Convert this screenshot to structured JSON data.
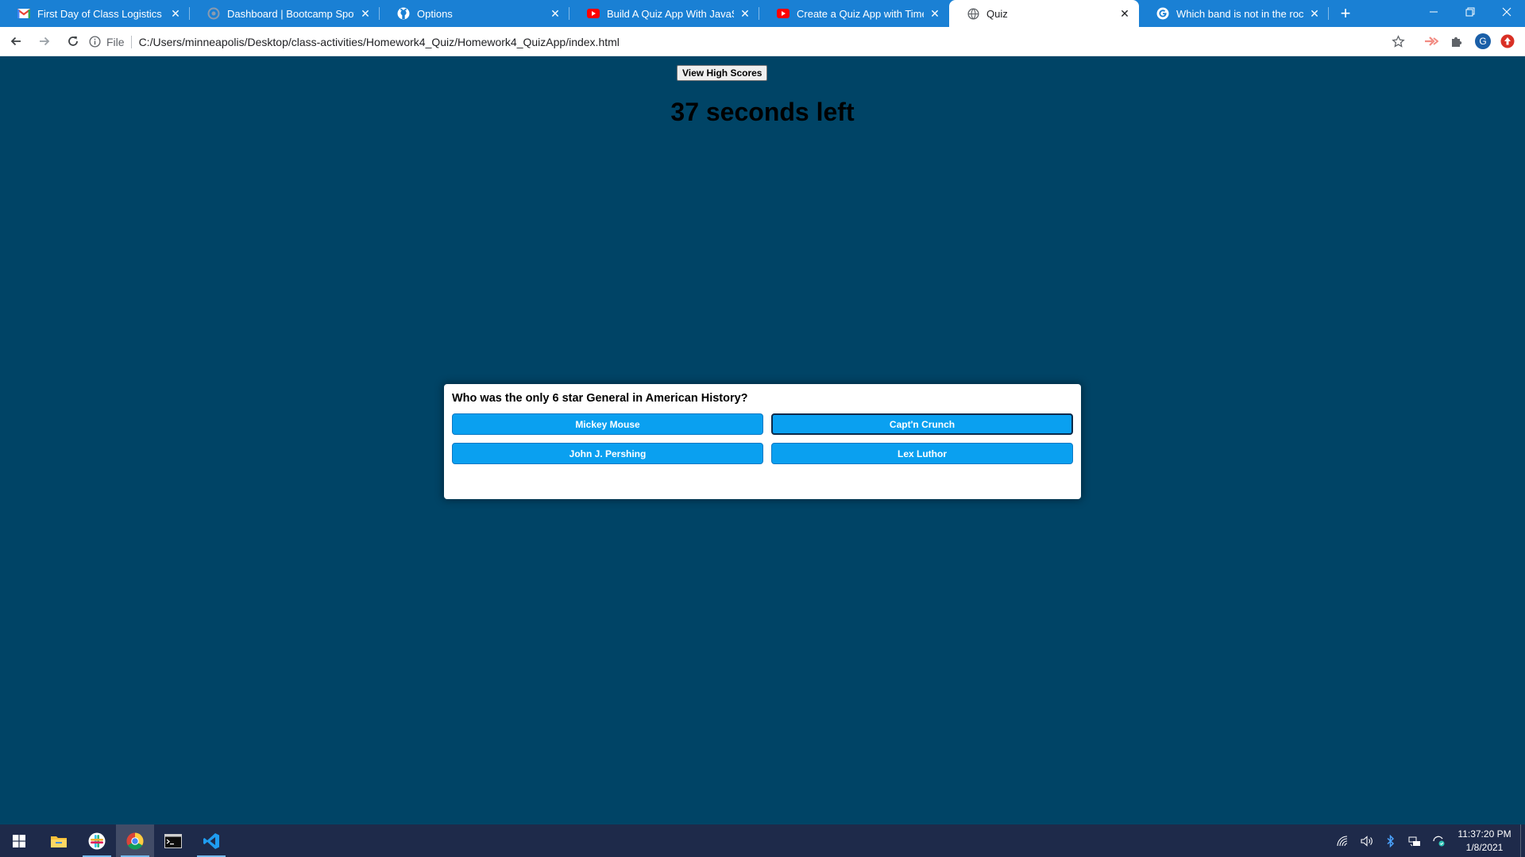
{
  "browser": {
    "tabs": [
      {
        "title": "First Day of Class Logistics - tony",
        "icon": "gmail-icon"
      },
      {
        "title": "Dashboard | Bootcamp Spot",
        "icon": "bootcamp-spot-icon"
      },
      {
        "title": "Options",
        "icon": "github-icon"
      },
      {
        "title": "Build A Quiz App With JavaScript",
        "icon": "youtube-icon"
      },
      {
        "title": "Create a Quiz App with Timer usi",
        "icon": "youtube-icon"
      },
      {
        "title": "Quiz",
        "icon": "globe-icon",
        "active": true
      },
      {
        "title": "Which band is not in the rock n r",
        "icon": "google-icon"
      }
    ],
    "address": {
      "scheme_label": "File",
      "url": "C:/Users/minneapolis/Desktop/class-activities/Homework4_Quiz/Homework4_QuizApp/index.html"
    },
    "profile_initial": "G"
  },
  "page": {
    "high_scores_label": "View High Scores",
    "timer_text": "37 seconds left",
    "quiz": {
      "question": "Who was the only 6 star General in American History?",
      "answers": [
        "Mickey Mouse",
        "Capt'n Crunch",
        "John J. Pershing",
        "Lex Luthor"
      ]
    }
  },
  "taskbar": {
    "pinned": [
      "windows-start-icon",
      "file-explorer-icon",
      "slack-icon",
      "chrome-icon",
      "terminal-icon",
      "vscode-icon"
    ],
    "clock": {
      "time": "11:37:20 PM",
      "date": "1/8/2021"
    }
  },
  "colors": {
    "page_background": "#004466",
    "answer_button": "#0aa0f0",
    "tab_strip": "#1a80d4",
    "taskbar": "#1e2a4a"
  }
}
